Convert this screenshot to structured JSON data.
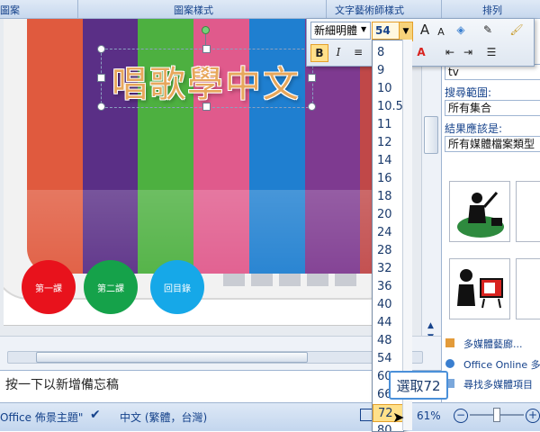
{
  "ribbon": {
    "partial_left": "圖案",
    "group_picture_style": "圖案樣式",
    "group_wordart": "文字藝術師樣式",
    "group_arrange": "排列"
  },
  "slide": {
    "title": "唱歌學中文",
    "bar_colors": [
      "#e05a3e",
      "#5a2f86",
      "#4db040",
      "#e05a8c",
      "#1f7fd0",
      "#7e3a90",
      "#c04848"
    ],
    "buttons": [
      {
        "label": "第一課",
        "color": "#e8121c"
      },
      {
        "label": "第二課",
        "color": "#15a24a"
      },
      {
        "label": "回目錄",
        "color": "#16a8e8"
      }
    ]
  },
  "notes": {
    "placeholder": "按一下以新增備忘稿"
  },
  "status_bar": {
    "theme": "Office 佈景主題\"",
    "language": "中文 (繁體，台灣)",
    "zoom": "61%"
  },
  "mini_toolbar": {
    "font_name": "新細明體",
    "font_size": "54",
    "bold": "B",
    "italic": "I",
    "grow_font": "A",
    "shrink_font": "A"
  },
  "font_size_dropdown": {
    "items": [
      "8",
      "9",
      "10",
      "10.5",
      "11",
      "12",
      "14",
      "16",
      "18",
      "20",
      "24",
      "28",
      "32",
      "36",
      "40",
      "44",
      "48",
      "54",
      "60",
      "66",
      "72",
      "80"
    ],
    "selected": "72"
  },
  "callout": {
    "text": "選取72"
  },
  "clip_pane": {
    "search_value": "tv",
    "search_scope_label": "搜尋範圍:",
    "search_scope_value": "所有集合",
    "result_type_label": "結果應該是:",
    "result_type_value": "所有媒體檔案類型",
    "link_organizer": "多媒體藝廊...",
    "link_online": "Office Online 多",
    "link_find": "尋找多媒體項目"
  }
}
